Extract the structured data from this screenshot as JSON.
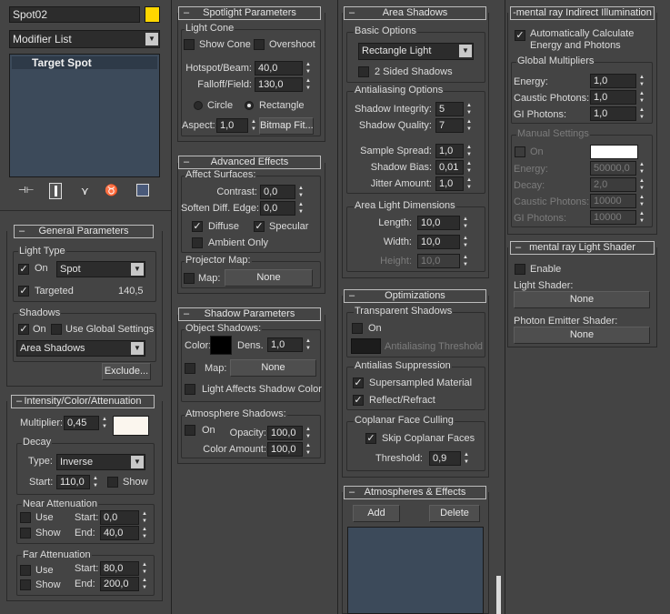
{
  "colors": {
    "panel": "#444444",
    "object_color": "#ffd700",
    "light_color": "#fbf6ee",
    "list_bg": "#3c4a5a",
    "photon_color": "#ffffff",
    "shadow_color": "#000000"
  },
  "top": {
    "object_name": "Spot02",
    "modifier_list": "Modifier List",
    "stack_item": "Target Spot",
    "tool_icons": [
      "pin-stack-icon",
      "show-end-result-icon",
      "make-unique-icon",
      "remove-modifier-icon",
      "configure-sets-icon"
    ]
  },
  "general": {
    "title": "General Parameters",
    "light_type_group": "Light Type",
    "on_label": "On",
    "on": true,
    "type_value": "Spot",
    "targeted_label": "Targeted",
    "targeted": true,
    "target_distance": "140,5",
    "shadows_group": "Shadows",
    "shadows_on_label": "On",
    "shadows_on": true,
    "use_global_label": "Use Global Settings",
    "use_global": false,
    "shadow_type": "Area Shadows",
    "exclude_label": "Exclude..."
  },
  "intensity": {
    "title": "Intensity/Color/Attenuation",
    "multiplier_label": "Multiplier:",
    "multiplier": "0,45",
    "decay_group": "Decay",
    "type_label": "Type:",
    "type_value": "Inverse",
    "start_label": "Start:",
    "start": "110,0",
    "show_label": "Show",
    "show": false,
    "near_group": "Near Attenuation",
    "near_use_label": "Use",
    "near_show_label": "Show",
    "near_start_label": "Start:",
    "near_start": "0,0",
    "near_end_label": "End:",
    "near_end": "40,0",
    "far_group": "Far Attenuation",
    "far_use_label": "Use",
    "far_show_label": "Show",
    "far_start_label": "Start:",
    "far_start": "80,0",
    "far_end_label": "End:",
    "far_end": "200,0"
  },
  "spotlight": {
    "title": "Spotlight Parameters",
    "light_cone_group": "Light Cone",
    "show_cone_label": "Show Cone",
    "overshoot_label": "Overshoot",
    "hotspot_label": "Hotspot/Beam:",
    "hotspot": "40,0",
    "falloff_label": "Falloff/Field:",
    "falloff": "130,0",
    "circle_label": "Circle",
    "rectangle_label": "Rectangle",
    "shape": "Rectangle",
    "aspect_label": "Aspect:",
    "aspect": "1,0",
    "bitmap_fit_label": "Bitmap Fit..."
  },
  "advanced": {
    "title": "Advanced Effects",
    "affect_group": "Affect Surfaces:",
    "contrast_label": "Contrast:",
    "contrast": "0,0",
    "soften_label": "Soften Diff. Edge:",
    "soften": "0,0",
    "diffuse_label": "Diffuse",
    "diffuse": true,
    "specular_label": "Specular",
    "specular": true,
    "ambient_label": "Ambient Only",
    "ambient": false,
    "projector_group": "Projector Map:",
    "map_label": "Map:",
    "map_value": "None"
  },
  "shadow_params": {
    "title": "Shadow Parameters",
    "object_group": "Object Shadows:",
    "color_label": "Color:",
    "dens_label": "Dens.",
    "dens": "1,0",
    "map_label": "Map:",
    "map_value": "None",
    "light_affects_label": "Light Affects Shadow Color",
    "atmo_group": "Atmosphere Shadows:",
    "atmo_on_label": "On",
    "opacity_label": "Opacity:",
    "opacity": "100,0",
    "color_amount_label": "Color Amount:",
    "color_amount": "100,0"
  },
  "area_shadows": {
    "title": "Area Shadows",
    "basic_group": "Basic Options",
    "light_type": "Rectangle Light",
    "two_sided_label": "2 Sided Shadows",
    "aa_group": "Antialiasing Options",
    "integrity_label": "Shadow Integrity:",
    "integrity": "5",
    "quality_label": "Shadow Quality:",
    "quality": "7",
    "sample_spread_label": "Sample Spread:",
    "sample_spread": "1,0",
    "bias_label": "Shadow Bias:",
    "bias": "0,01",
    "jitter_label": "Jitter Amount:",
    "jitter": "1,0",
    "dims_group": "Area Light Dimensions",
    "length_label": "Length:",
    "length": "10,0",
    "width_label": "Width:",
    "width": "10,0",
    "height_label": "Height:",
    "height": "10,0"
  },
  "optimizations": {
    "title": "Optimizations",
    "transparent_group": "Transparent Shadows",
    "on_label": "On",
    "aa_threshold_label": "Antialiasing Threshold",
    "suppression_group": "Antialias Suppression",
    "supersampled_label": "Supersampled Material",
    "supersampled": true,
    "reflect_label": "Reflect/Refract",
    "reflect": true,
    "coplanar_group": "Coplanar Face Culling",
    "skip_label": "Skip Coplanar Faces",
    "skip": true,
    "threshold_label": "Threshold:",
    "threshold": "0,9"
  },
  "atmospheres": {
    "title": "Atmospheres & Effects",
    "add_label": "Add",
    "delete_label": "Delete"
  },
  "indirect": {
    "title": "-mental ray Indirect Illumination",
    "auto_label": "Automatically Calculate Energy and Photons",
    "auto": true,
    "global_group": "Global Multipliers",
    "energy_label": "Energy:",
    "energy": "1,0",
    "caustic_label": "Caustic Photons:",
    "caustic": "1,0",
    "gi_label": "GI Photons:",
    "gi": "1,0",
    "manual_group": "Manual Settings",
    "manual_on_label": "On",
    "m_energy_label": "Energy:",
    "m_energy": "50000,0",
    "decay_label": "Decay:",
    "decay": "2,0",
    "m_caustic_label": "Caustic Photons:",
    "m_caustic": "10000",
    "m_gi_label": "GI Photons:",
    "m_gi": "10000"
  },
  "shader": {
    "title": "mental ray Light Shader",
    "enable_label": "Enable",
    "light_shader_label": "Light Shader:",
    "light_shader_value": "None",
    "photon_label": "Photon Emitter Shader:",
    "photon_value": "None"
  }
}
